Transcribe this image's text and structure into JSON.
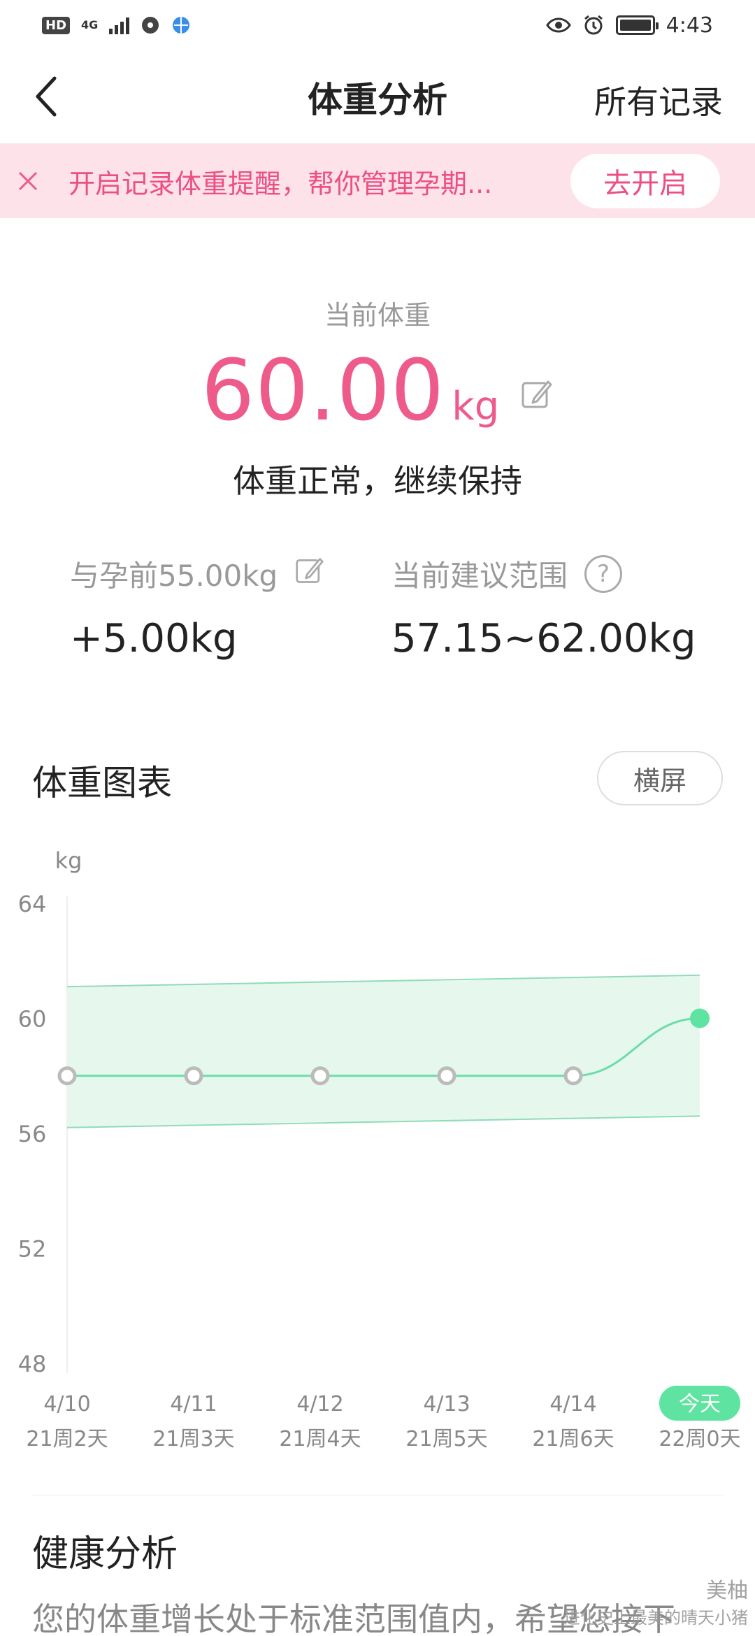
{
  "status_bar": {
    "hd": "HD",
    "network": "4G",
    "time": "4:43"
  },
  "header": {
    "title": "体重分析",
    "right_link": "所有记录"
  },
  "banner": {
    "message": "开启记录体重提醒，帮你管理孕期...",
    "button": "去开启"
  },
  "current": {
    "label": "当前体重",
    "value": "60.00",
    "unit": "kg",
    "status": "体重正常，继续保持"
  },
  "stats": {
    "pre_label": "与孕前55.00kg",
    "pre_value": "+5.00kg",
    "range_label": "当前建议范围",
    "range_value": "57.15~62.00kg"
  },
  "chart_section": {
    "title": "体重图表",
    "landscape_button": "横屏"
  },
  "chart_data": {
    "type": "line",
    "ylabel": "kg",
    "ylim": [
      48,
      64
    ],
    "yticks": [
      "64",
      "60",
      "56",
      "52",
      "48"
    ],
    "ytick_values": [
      64,
      60,
      56,
      52,
      48
    ],
    "categories": [
      "4/10",
      "4/11",
      "4/12",
      "4/13",
      "4/14",
      "今天"
    ],
    "sublabels": [
      "21周2天",
      "21周3天",
      "21周4天",
      "21周5天",
      "21周6天",
      "22周0天"
    ],
    "values": [
      58,
      58,
      58,
      58,
      58,
      60
    ],
    "band_low": [
      56.2,
      56.3,
      56.4,
      56.4,
      56.5,
      56.6
    ],
    "band_high": [
      61.1,
      61.2,
      61.3,
      61.3,
      61.4,
      61.5
    ],
    "highlight_index": 5,
    "colors": {
      "line": "#6ddcaa",
      "band": "#e6f7ee",
      "band_edge": "#8fdcb8",
      "point": "#bbbbbb",
      "today": "#5ee3a1"
    }
  },
  "health": {
    "title": "健康分析",
    "text": "您的体重增长处于标准范围值内，希望您接下"
  },
  "watermark": {
    "brand": "美柚",
    "sub": "进化史上最美的晴天小猪"
  }
}
